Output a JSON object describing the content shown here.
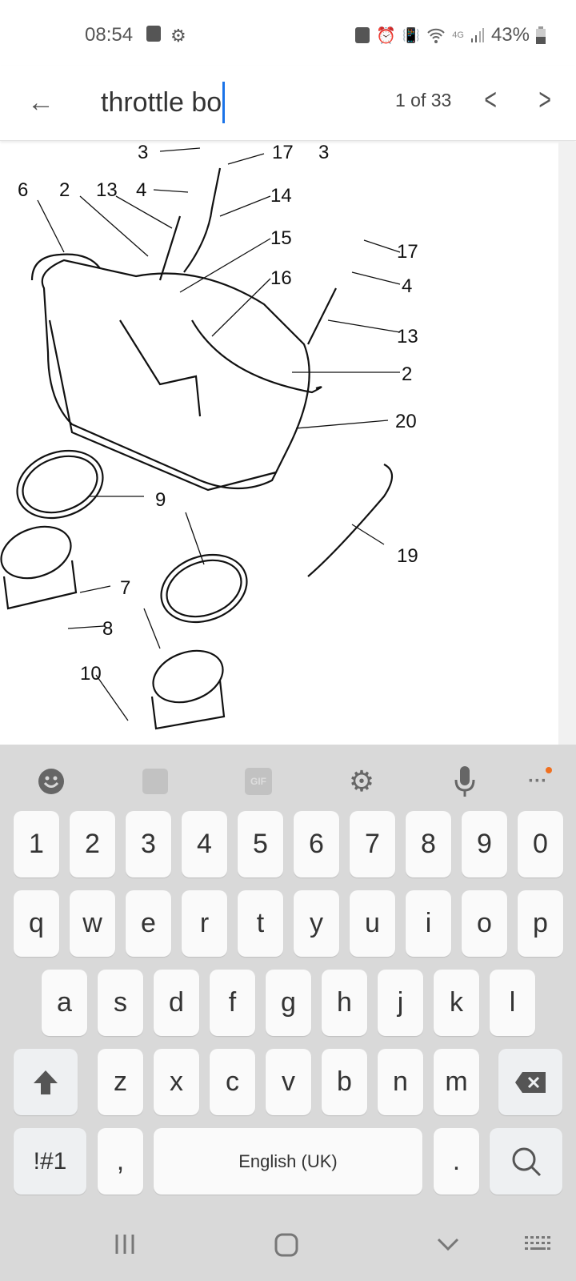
{
  "status_bar": {
    "time": "08:54",
    "battery": "43%",
    "network": "4G",
    "icons": [
      "clock-icon",
      "settings-icon",
      "nfc-icon",
      "alarm-icon",
      "vibrate-icon",
      "wifi-icon",
      "signal-icon",
      "battery-icon"
    ]
  },
  "find_bar": {
    "query": "throttle bo",
    "match_count": "1 of 33",
    "icons": [
      "back-arrow-icon",
      "chevron-left-icon",
      "chevron-right-icon"
    ]
  },
  "diagram": {
    "part_labels": [
      "3",
      "17",
      "3",
      "6",
      "2",
      "13",
      "4",
      "14",
      "15",
      "17",
      "16",
      "4",
      "13",
      "2",
      "20",
      "9",
      "19",
      "7",
      "8",
      "10"
    ]
  },
  "keyboard": {
    "toolbar": [
      "emoji-icon",
      "sticker-icon",
      "gif-icon",
      "settings-icon",
      "microphone-icon",
      "more-icon"
    ],
    "gif_label": "GIF",
    "accent": "#f07020",
    "rows": [
      [
        "1",
        "2",
        "3",
        "4",
        "5",
        "6",
        "7",
        "8",
        "9",
        "0"
      ],
      [
        "q",
        "w",
        "e",
        "r",
        "t",
        "y",
        "u",
        "i",
        "o",
        "p"
      ],
      [
        "a",
        "s",
        "d",
        "f",
        "g",
        "h",
        "j",
        "k",
        "l"
      ],
      [
        "z",
        "x",
        "c",
        "v",
        "b",
        "n",
        "m"
      ]
    ],
    "symbols": "!#1",
    "comma": ",",
    "space": "English (UK)",
    "period": "."
  },
  "nav_bar": [
    "recents-icon",
    "home-icon",
    "back-icon",
    "keyboard-icon"
  ]
}
